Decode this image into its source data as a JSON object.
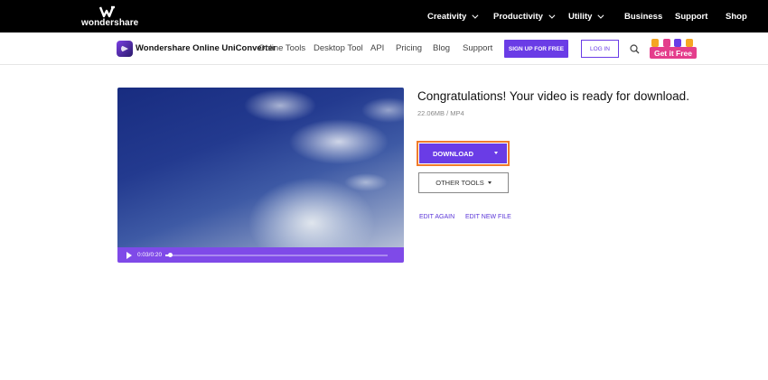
{
  "brand": {
    "name": "wondershare"
  },
  "topnav": [
    {
      "label": "Creativity",
      "has_menu": true
    },
    {
      "label": "Productivity",
      "has_menu": true
    },
    {
      "label": "Utility",
      "has_menu": true
    },
    {
      "label": "Business",
      "has_menu": false
    },
    {
      "label": "Support",
      "has_menu": false
    },
    {
      "label": "Shop",
      "has_menu": false
    }
  ],
  "subnav": {
    "app_name": "Wondershare Online UniConverter",
    "links": [
      "Online Tools",
      "Desktop Tool",
      "API",
      "Pricing",
      "Blog",
      "Support"
    ],
    "signup_label": "SIGN UP FOR FREE",
    "login_label": "LOG IN",
    "promo_label": "Get it Free"
  },
  "player": {
    "time": "0:03/0:20",
    "progress": 0.02
  },
  "result": {
    "title": "Congratulations! Your video is ready for download.",
    "meta": "22.06MB / MP4",
    "download_label": "DOWNLOAD",
    "other_tools_label": "OTHER TOOLS",
    "edit_again_label": "EDIT AGAIN",
    "edit_new_label": "EDIT NEW FILE"
  },
  "colors": {
    "accent": "#6a3ce6",
    "player_bar": "#7f4ae8",
    "highlight": "#f07b2b",
    "promo": "#e43d8c"
  }
}
